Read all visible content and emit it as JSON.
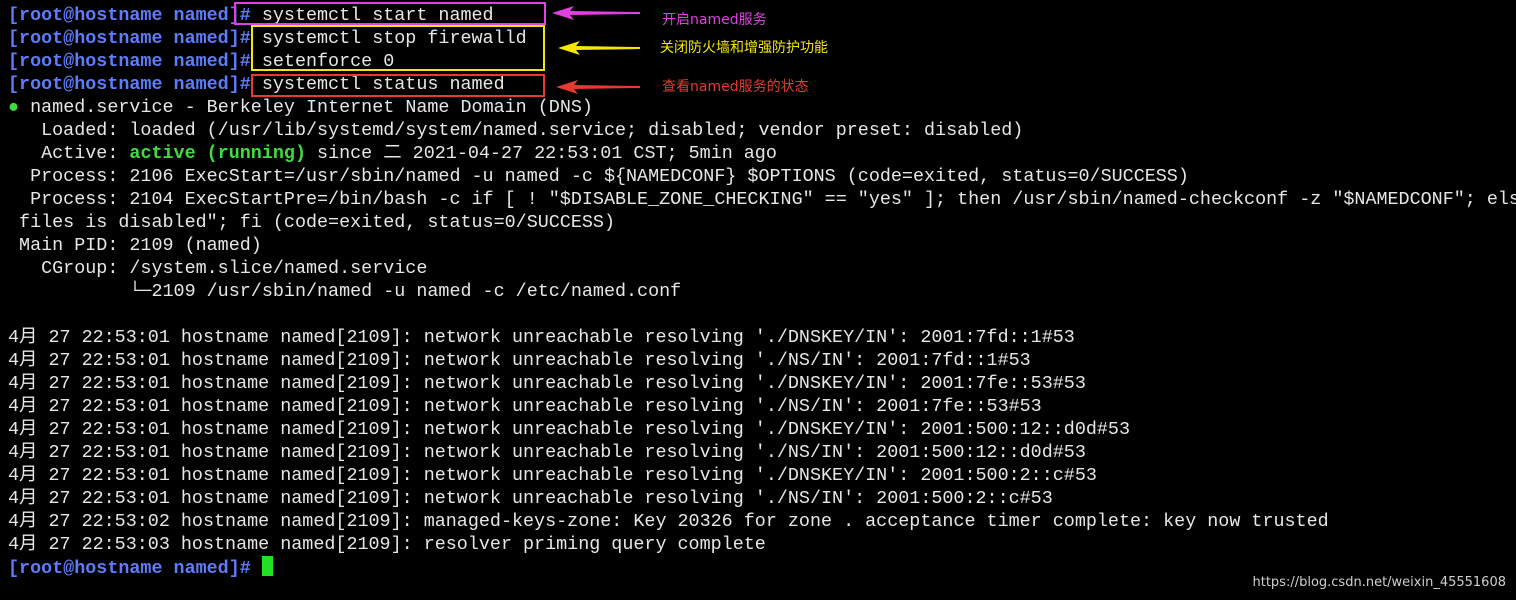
{
  "prompt": "[root@hostname named]#",
  "commands": {
    "start": " systemctl start named",
    "stop_firewall": " systemctl stop firewalld",
    "setenforce": " setenforce 0",
    "status": " systemctl status named"
  },
  "status": {
    "dot": "●",
    "service_line": " named.service - Berkeley Internet Name Domain (DNS)",
    "loaded": "   Loaded: loaded (/usr/lib/systemd/system/named.service; disabled; vendor preset: disabled)",
    "active_label": "   Active: ",
    "active_state": "active (running)",
    "active_since": " since 二 2021-04-27 22:53:01 CST; 5min ago",
    "process1": "  Process: 2106 ExecStart=/usr/sbin/named -u named -c ${NAMEDCONF} $OPTIONS (code=exited, status=0/SUCCESS)",
    "process2": "  Process: 2104 ExecStartPre=/bin/bash -c if [ ! \"$DISABLE_ZONE_CHECKING\" == \"yes\" ]; then /usr/sbin/named-checkconf -z \"$NAMEDCONF\"; else",
    "process2_cont": " files is disabled\"; fi (code=exited, status=0/SUCCESS)",
    "main_pid": " Main PID: 2109 (named)",
    "cgroup": "   CGroup: /system.slice/named.service",
    "cgroup_child": "           └─2109 /usr/sbin/named -u named -c /etc/named.conf"
  },
  "logs": [
    "4月 27 22:53:01 hostname named[2109]: network unreachable resolving './DNSKEY/IN': 2001:7fd::1#53",
    "4月 27 22:53:01 hostname named[2109]: network unreachable resolving './NS/IN': 2001:7fd::1#53",
    "4月 27 22:53:01 hostname named[2109]: network unreachable resolving './DNSKEY/IN': 2001:7fe::53#53",
    "4月 27 22:53:01 hostname named[2109]: network unreachable resolving './NS/IN': 2001:7fe::53#53",
    "4月 27 22:53:01 hostname named[2109]: network unreachable resolving './DNSKEY/IN': 2001:500:12::d0d#53",
    "4月 27 22:53:01 hostname named[2109]: network unreachable resolving './NS/IN': 2001:500:12::d0d#53",
    "4月 27 22:53:01 hostname named[2109]: network unreachable resolving './DNSKEY/IN': 2001:500:2::c#53",
    "4月 27 22:53:01 hostname named[2109]: network unreachable resolving './NS/IN': 2001:500:2::c#53",
    "4月 27 22:53:02 hostname named[2109]: managed-keys-zone: Key 20326 for zone . acceptance timer complete: key now trusted",
    "4月 27 22:53:03 hostname named[2109]: resolver priming query complete"
  ],
  "annotations": {
    "start": "开启named服务",
    "firewall": "关闭防火墙和增强防护功能",
    "status": "查看named服务的状态"
  },
  "colors": {
    "background": "#000000",
    "prompt": "#5c7cfa",
    "active": "#3fdc3f",
    "magenta": "#e040e0",
    "yellow": "#f5e600",
    "red": "#e8392e"
  },
  "watermark": "https://blog.csdn.net/weixin_45551608"
}
